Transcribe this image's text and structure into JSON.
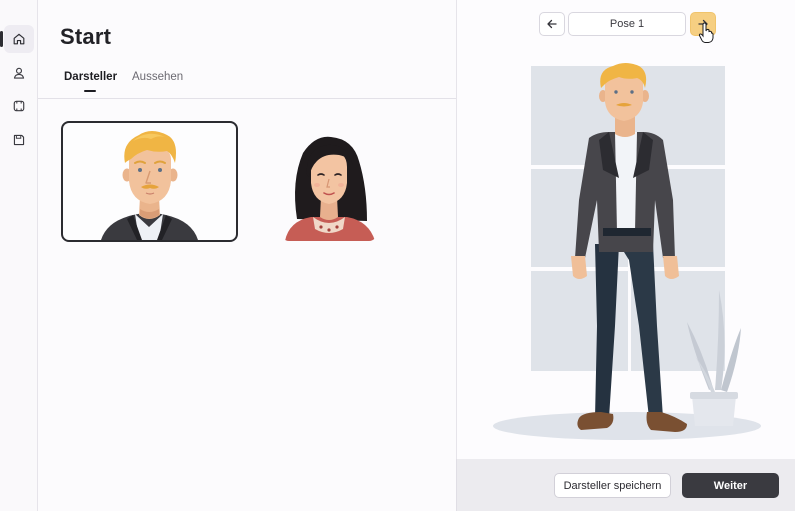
{
  "sidebar": {
    "items": [
      {
        "name": "home",
        "icon": "home-icon",
        "active": true
      },
      {
        "name": "profile",
        "icon": "person-icon",
        "active": false
      },
      {
        "name": "package",
        "icon": "package-icon",
        "active": false
      },
      {
        "name": "save",
        "icon": "save-icon",
        "active": false
      }
    ]
  },
  "header": {
    "title": "Start"
  },
  "tabs": [
    {
      "label": "Darsteller",
      "active": true
    },
    {
      "label": "Aussehen",
      "active": false
    }
  ],
  "characters": [
    {
      "name": "man-blond",
      "selected": true
    },
    {
      "name": "woman-dark-hair",
      "selected": false
    }
  ],
  "preview": {
    "pose_label": "Pose 1",
    "prev_icon": "arrow-left-icon",
    "next_icon": "arrow-right-icon"
  },
  "footer": {
    "save_label": "Darsteller speichern",
    "next_label": "Weiter"
  },
  "colors": {
    "accent": "#f6cf82",
    "primary_button": "#3a3a40"
  }
}
